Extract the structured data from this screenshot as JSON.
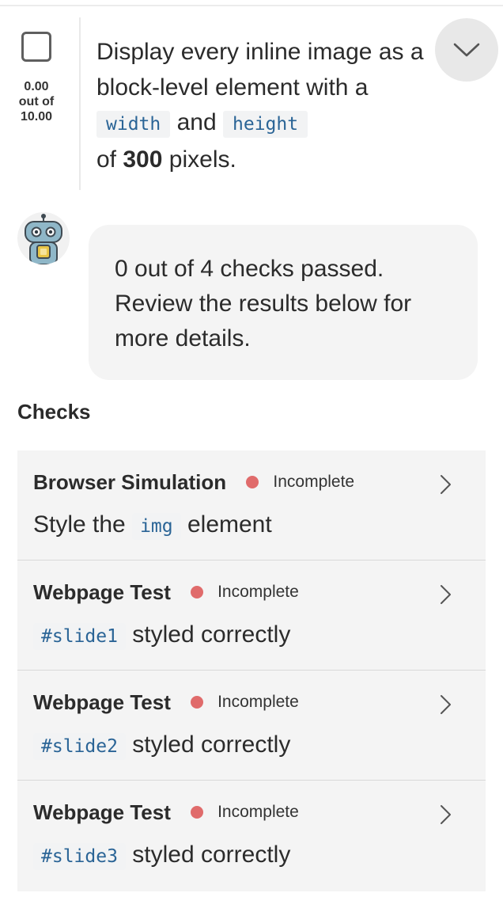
{
  "task": {
    "score_value": "0.00",
    "score_out_of": "out of",
    "score_total": "10.00",
    "text_part1": "Display every inline image as a block-level element with a",
    "code1": "width",
    "text_part2": "and",
    "code2": "height",
    "text_part3": "of",
    "bold_value": "300",
    "text_part4": "pixels."
  },
  "feedback": {
    "avatar_icon": "robot-icon",
    "message": "0 out of 4 checks passed. Review the results below for more details."
  },
  "checks": {
    "heading": "Checks",
    "status_color": "#e06b6b",
    "items": [
      {
        "type": "Browser Simulation",
        "status": "Incomplete",
        "desc_prefix": "Style the",
        "code": "img",
        "desc_suffix": "element"
      },
      {
        "type": "Webpage Test",
        "status": "Incomplete",
        "desc_prefix": "",
        "code": "#slide1",
        "desc_suffix": "styled correctly"
      },
      {
        "type": "Webpage Test",
        "status": "Incomplete",
        "desc_prefix": "",
        "code": "#slide2",
        "desc_suffix": "styled correctly"
      },
      {
        "type": "Webpage Test",
        "status": "Incomplete",
        "desc_prefix": "",
        "code": "#slide3",
        "desc_suffix": "styled correctly"
      }
    ]
  }
}
